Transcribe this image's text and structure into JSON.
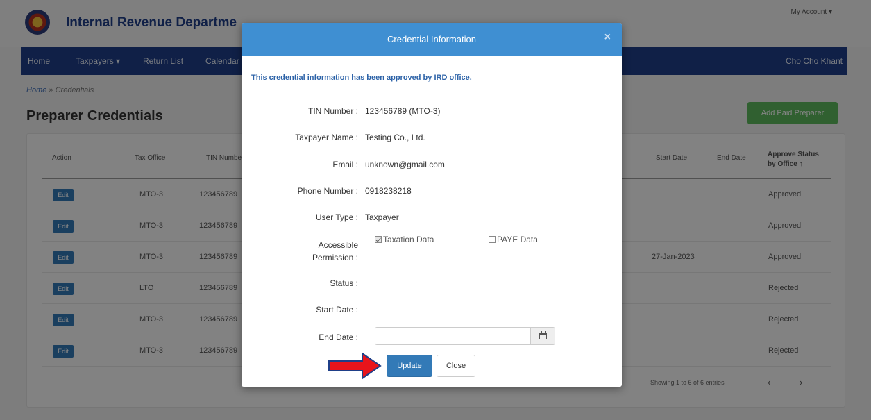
{
  "header": {
    "brand": "Internal Revenue Departme",
    "my_account": "My Account ▾"
  },
  "nav": {
    "items": [
      "Home",
      "Taxpayers ▾",
      "Return List",
      "Calendar"
    ],
    "user": "Cho Cho Khant"
  },
  "breadcrumb": {
    "home": "Home",
    "separator": "»",
    "current": "Credentials"
  },
  "page": {
    "title": "Preparer Credentials",
    "add_button": "Add Paid Preparer"
  },
  "table": {
    "headers": {
      "action": "Action",
      "tax_office": "Tax Office",
      "tin": "TIN Numbe",
      "start_date": "Start Date",
      "end_date": "End Date",
      "status_line1": "Approve Status",
      "status_line2": "by Office ↑"
    },
    "rows": [
      {
        "edit": "Edit",
        "office": "MTO-3",
        "tin": "123456789",
        "start": "",
        "status": "Approved"
      },
      {
        "edit": "Edit",
        "office": "MTO-3",
        "tin": "123456789",
        "start": "",
        "status": "Approved"
      },
      {
        "edit": "Edit",
        "office": "MTO-3",
        "tin": "123456789",
        "start": "27-Jan-2023",
        "status": "Approved"
      },
      {
        "edit": "Edit",
        "office": "LTO",
        "tin": "123456789",
        "start": "",
        "status": "Rejected"
      },
      {
        "edit": "Edit",
        "office": "MTO-3",
        "tin": "123456789",
        "start": "",
        "status": "Rejected"
      },
      {
        "edit": "Edit",
        "office": "MTO-3",
        "tin": "123456789",
        "start": "",
        "status": "Rejected"
      }
    ],
    "info": "Showing 1 to 6 of 6 entries",
    "prev": "‹",
    "next": "›"
  },
  "modal": {
    "title": "Credential Information",
    "close_icon": "×",
    "notice": "This credential information has been approved by IRD office.",
    "fields": {
      "tin_label": "TIN Number :",
      "tin_value": "123456789 (MTO-3)",
      "name_label": "Taxpayer Name :",
      "name_value": "Testing Co., Ltd.",
      "email_label": "Email :",
      "email_value": "unknown@gmail.com",
      "phone_label": "Phone Number :",
      "phone_value": "0918238218",
      "usertype_label": "User Type :",
      "usertype_value": "Taxpayer",
      "perm_label_1": "Accessible",
      "perm_label_2": "Permission :",
      "perm_taxation": "Taxation Data",
      "perm_paye": "PAYE Data",
      "status_label": "Status :",
      "startdate_label": "Start Date :",
      "enddate_label": "End Date :",
      "enddate_value": ""
    },
    "update_button": "Update",
    "close_button": "Close",
    "accent_color": "#3f8fd2",
    "arrow_color": "#e8141b"
  }
}
